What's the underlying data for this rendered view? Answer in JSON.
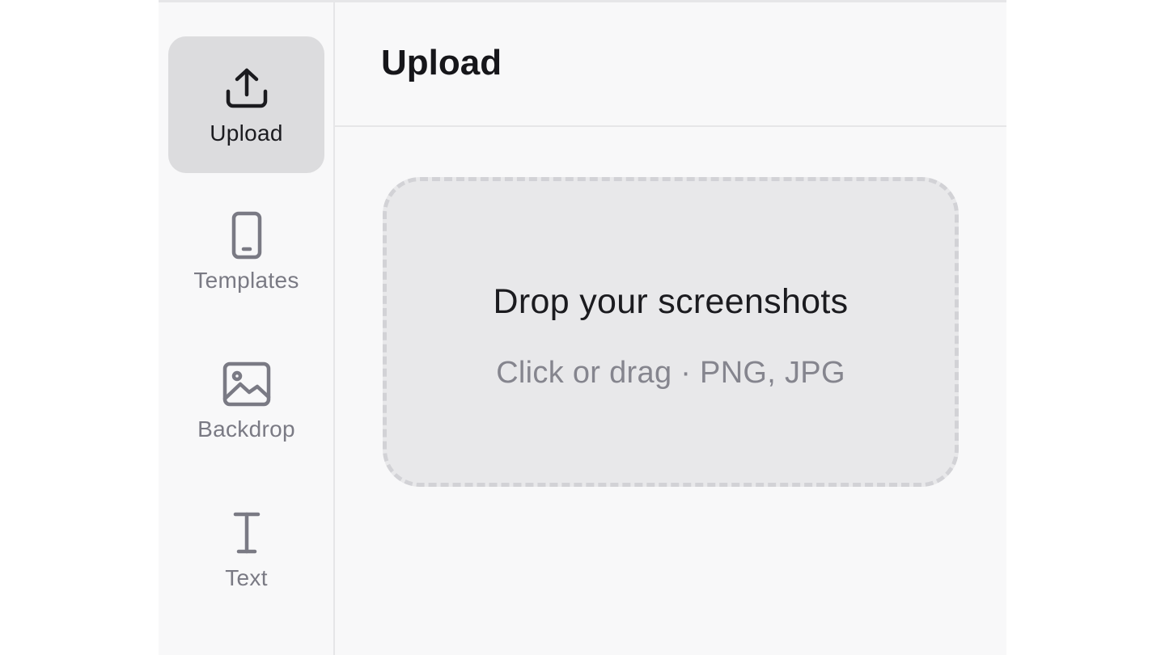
{
  "sidebar": {
    "items": [
      {
        "label": "Upload",
        "icon": "upload-icon",
        "active": true
      },
      {
        "label": "Templates",
        "icon": "phone-icon",
        "active": false
      },
      {
        "label": "Backdrop",
        "icon": "image-icon",
        "active": false
      },
      {
        "label": "Text",
        "icon": "text-cursor-icon",
        "active": false
      }
    ]
  },
  "main": {
    "title": "Upload",
    "dropzone": {
      "title": "Drop your screenshots",
      "subtitle": "Click or drag · PNG, JPG"
    }
  },
  "colors": {
    "active_bg": "#dcdcde",
    "panel_bg": "#f8f8f9",
    "dropzone_bg": "#e8e8ea",
    "text_primary": "#1b1b1f",
    "text_muted": "#7a7a84"
  }
}
